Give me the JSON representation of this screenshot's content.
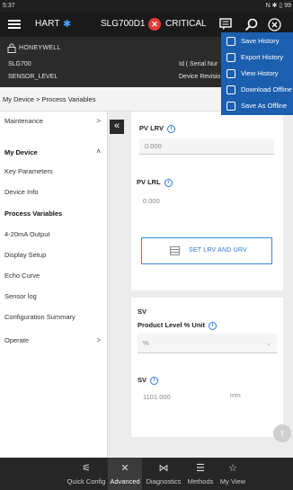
{
  "status_bar": {
    "time": "5:37",
    "indicators": "N ✱ ▯ 99"
  },
  "app_bar": {
    "protocol": "HART",
    "device_tag": "SLG700D1",
    "status": "CRITICAL",
    "status_color": "#e53935"
  },
  "device_header": {
    "vendor": "HONEYWELL",
    "model": "SLG700",
    "tag": "SENSOR_LEVEL",
    "serial_label": "Id ( Serial Nur",
    "revision_label": "Device Revisio"
  },
  "breadcrumb": "My Device > Process Variables",
  "sidebar": {
    "items": [
      {
        "label": "Maintenance",
        "chevron": ">"
      },
      {
        "label": "My Device",
        "chevron": "^"
      },
      {
        "label": "Key Parameters"
      },
      {
        "label": "Device Info"
      },
      {
        "label": "Process Variables"
      },
      {
        "label": "4-20mA Output"
      },
      {
        "label": "Display Setup"
      },
      {
        "label": "Echo Curve"
      },
      {
        "label": "Sensor log"
      },
      {
        "label": "Configuration Summary"
      },
      {
        "label": "Operate",
        "chevron": ">"
      }
    ],
    "collapse_glyph": "«"
  },
  "panel1": {
    "pv_lrv_label": "PV LRV",
    "pv_lrv_value": "0.000",
    "pv_lrl_label": "PV LRL",
    "pv_lrl_value": "0.000",
    "set_button": "SET LRV AND URV"
  },
  "panel2": {
    "section_title": "SV",
    "unit_label": "Product Level % Unit",
    "unit_value": "%",
    "sv_label": "SV",
    "sv_value": "1101.000",
    "sv_unit": "mm"
  },
  "menu": {
    "items": [
      {
        "label": "Save History"
      },
      {
        "label": "Export History"
      },
      {
        "label": "View History"
      },
      {
        "label": "Download Offline"
      },
      {
        "label": "Save As Offline"
      }
    ]
  },
  "bottom_nav": {
    "tabs": [
      {
        "label": "Quick Config",
        "icon": "⚟"
      },
      {
        "label": "Advanced",
        "icon": "✕"
      },
      {
        "label": "Diagnostics",
        "icon": "⋈"
      },
      {
        "label": "Methods",
        "icon": "☰"
      },
      {
        "label": "My View",
        "icon": "☆"
      }
    ]
  },
  "colors": {
    "accent": "#2a7ad4",
    "menu_bg": "#1b5fae",
    "bluetooth": "#4aa3ff"
  }
}
